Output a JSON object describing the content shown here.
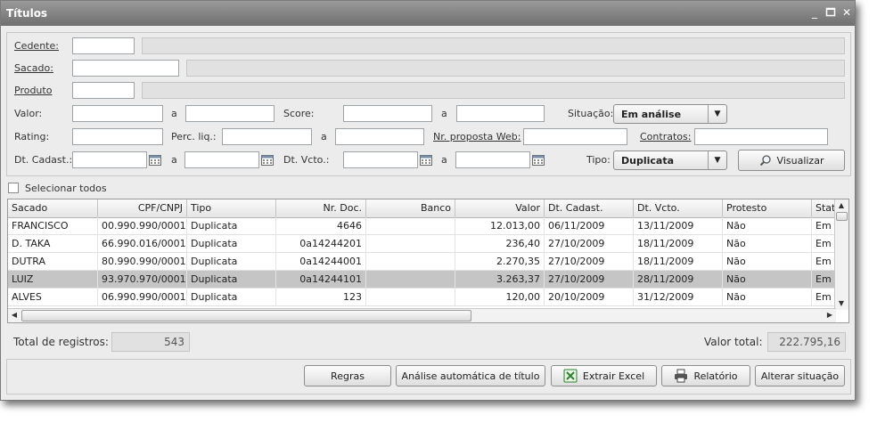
{
  "window": {
    "title": "Títulos"
  },
  "filters": {
    "cedente_label": "Cedente:",
    "sacado_label": "Sacado:",
    "produto_label": "Produto",
    "valor_label": "Valor:",
    "a": "a",
    "score_label": "Score:",
    "situacao_label": "Situação:",
    "situacao_value": "Em análise",
    "rating_label": "Rating:",
    "perc_liq_label": "Perc. liq.:",
    "nr_proposta_label": "Nr. proposta Web:",
    "contratos_label": "Contratos:",
    "dt_cadast_label": "Dt. Cadast.:",
    "dt_vcto_label": "Dt. Vcto.:",
    "tipo_label": "Tipo:",
    "tipo_value": "Duplicata",
    "visualizar": "Visualizar"
  },
  "select_all": "Selecionar todos",
  "table": {
    "columns": [
      "Sacado",
      "CPF/CNPJ",
      "Tipo",
      "Nr. Doc.",
      "Banco",
      "Valor",
      "Dt. Cadast.",
      "Dt. Vcto.",
      "Protesto",
      "Stat"
    ],
    "rows": [
      [
        "FRANCISCO",
        "00.990.990/0001-",
        "Duplicata",
        "4646",
        "",
        "12.013,00",
        "06/11/2009",
        "13/11/2009",
        "Não",
        "Em"
      ],
      [
        "D. TAKA",
        "66.990.016/0001-",
        "Duplicata",
        "0a14244201",
        "",
        "236,40",
        "27/10/2009",
        "18/11/2009",
        "Não",
        "Em"
      ],
      [
        "DUTRA",
        "80.990.990/0001-",
        "Duplicata",
        "0a14244001",
        "",
        "2.270,35",
        "27/10/2009",
        "18/11/2009",
        "Não",
        "Em"
      ],
      [
        "LUIZ",
        "93.970.970/0001-",
        "Duplicata",
        "0a14244101",
        "",
        "3.263,37",
        "27/10/2009",
        "28/11/2009",
        "Não",
        "Em"
      ],
      [
        "ALVES",
        "06.990.990/0001-",
        "Duplicata",
        "123",
        "",
        "120,00",
        "20/10/2009",
        "31/12/2009",
        "Não",
        "Em"
      ]
    ],
    "selected_row": 3
  },
  "totals": {
    "registros_label": "Total de registros:",
    "registros_value": "543",
    "valor_label": "Valor total:",
    "valor_value": "222.795,16"
  },
  "actions": {
    "regras": "Regras",
    "analise": "Análise automática de título",
    "excel": "Extrair Excel",
    "relatorio": "Relatório",
    "alterar": "Alterar situação"
  }
}
